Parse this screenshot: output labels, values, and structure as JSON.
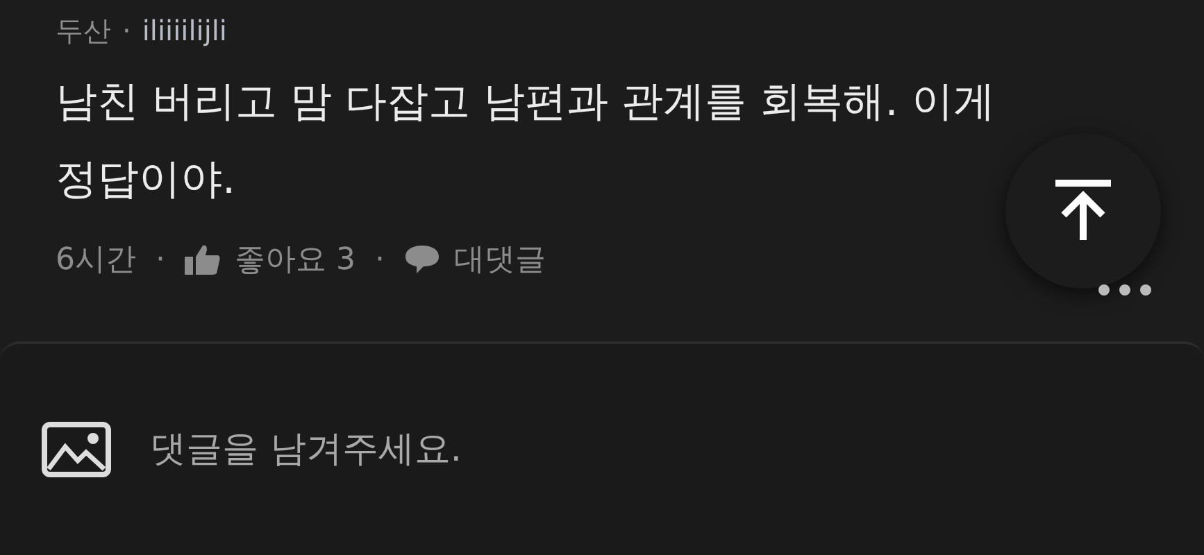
{
  "comment": {
    "author": "두산",
    "separator": "·",
    "nickname": "iliiiilijli",
    "body": "남친 버리고 맘 다잡고 남편과 관계를 회복해. 이게 정답이야.",
    "time": "6시간",
    "like_label": "좋아요 3",
    "reply_label": "대댓글",
    "dot": "·",
    "liked": false
  },
  "composer": {
    "placeholder": "댓글을 남겨주세요."
  }
}
